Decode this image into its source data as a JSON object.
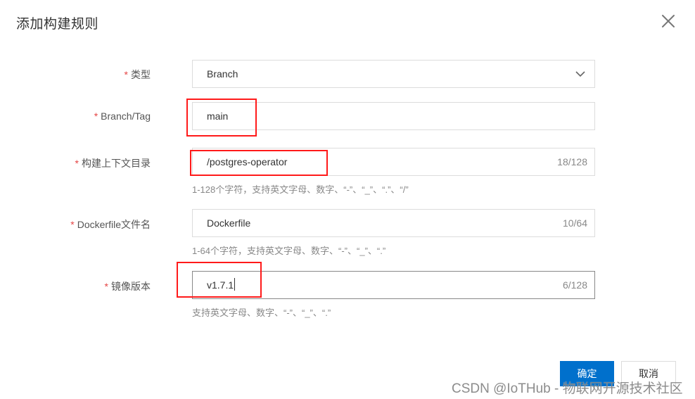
{
  "dialog": {
    "title": "添加构建规则",
    "close_icon": "close-icon"
  },
  "form": {
    "required_mark": "*",
    "type": {
      "label": "类型",
      "selected": "Branch",
      "icon": "chevron-down-icon"
    },
    "branch_tag": {
      "label": "Branch/Tag",
      "value": "main"
    },
    "context_dir": {
      "label": "构建上下文目录",
      "value": "/postgres-operator",
      "counter": "18/128",
      "hint": "1-128个字符，支持英文字母、数字、“-”、“_”、“.”、“/”"
    },
    "dockerfile": {
      "label": "Dockerfile文件名",
      "value": "Dockerfile",
      "counter": "10/64",
      "hint": "1-64个字符，支持英文字母、数字、“-”、“_”、“.”"
    },
    "image_version": {
      "label": "镜像版本",
      "value": "v1.7.1",
      "counter": "6/128",
      "hint": "支持英文字母、数字、“-”、“_”、“.”"
    }
  },
  "footer": {
    "confirm_label": "确定",
    "cancel_label": "取消"
  },
  "colors": {
    "primary": "#0070cc",
    "required": "#e54545",
    "annotation": "#ff1a1a"
  },
  "watermark": "CSDN @IoTHub - 物联网开源技术社区"
}
